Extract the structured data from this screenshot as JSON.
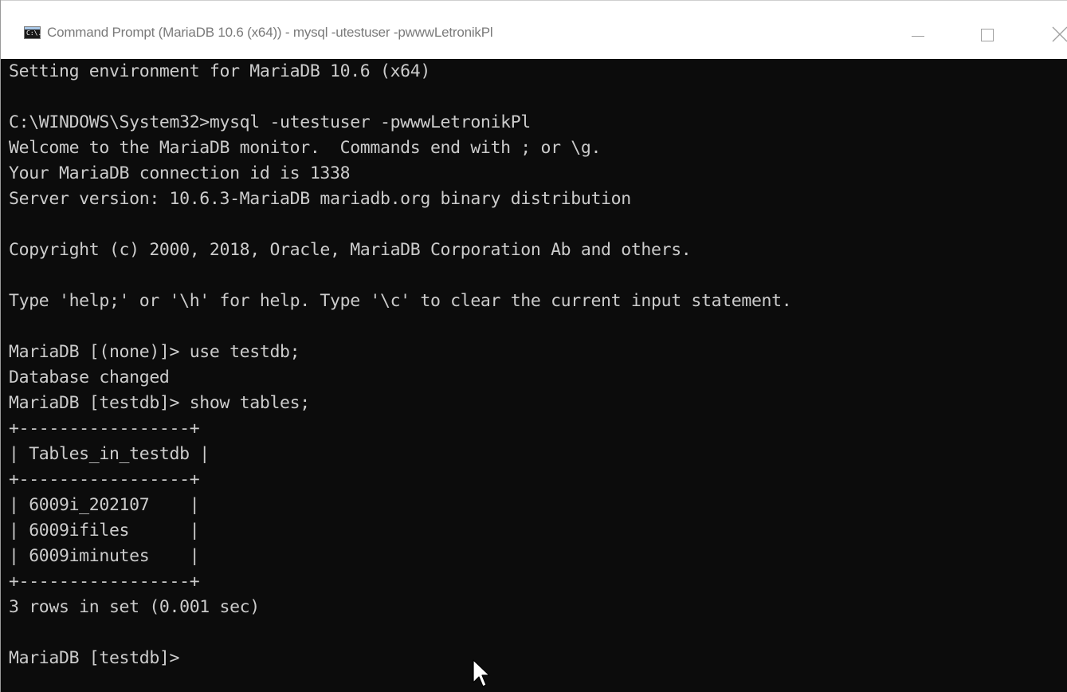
{
  "window": {
    "title": "Command Prompt (MariaDB 10.6 (x64)) - mysql  -utestuser -pwwwLetronikPl",
    "icon": "console-app-icon",
    "icon_text": "C:\\.",
    "controls": {
      "minimize": "minimize-icon",
      "maximize": "maximize-icon",
      "close": "close-icon"
    }
  },
  "colors": {
    "terminal_bg": "#0c0c0c",
    "terminal_fg": "#cccccc",
    "titlebar_bg": "#ffffff",
    "titlebar_text": "#7a7a7a"
  },
  "terminal": {
    "lines": [
      "Setting environment for MariaDB 10.6 (x64)",
      "",
      "C:\\WINDOWS\\System32>mysql -utestuser -pwwwLetronikPl",
      "Welcome to the MariaDB monitor.  Commands end with ; or \\g.",
      "Your MariaDB connection id is 1338",
      "Server version: 10.6.3-MariaDB mariadb.org binary distribution",
      "",
      "Copyright (c) 2000, 2018, Oracle, MariaDB Corporation Ab and others.",
      "",
      "Type 'help;' or '\\h' for help. Type '\\c' to clear the current input statement.",
      "",
      "MariaDB [(none)]> use testdb;",
      "Database changed",
      "MariaDB [testdb]> show tables;",
      "+-----------------+",
      "| Tables_in_testdb |",
      "+-----------------+",
      "| 6009i_202107    |",
      "| 6009ifiles      |",
      "| 6009iminutes    |",
      "+-----------------+",
      "3 rows in set (0.001 sec)",
      "",
      "MariaDB [testdb]>"
    ]
  },
  "mouse_pointer": "arrow-cursor-icon"
}
